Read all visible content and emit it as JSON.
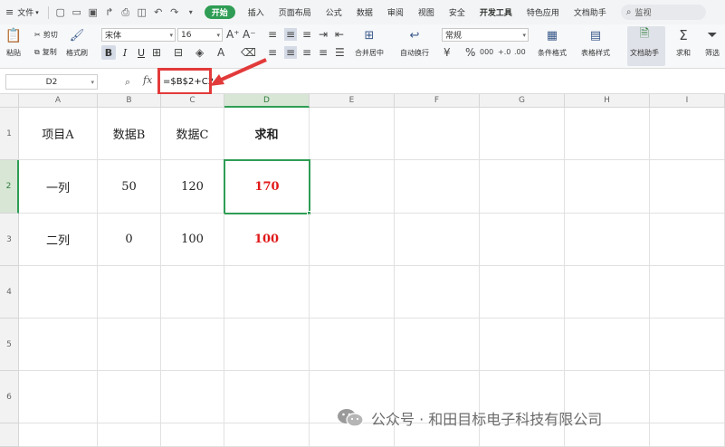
{
  "menubar": {
    "file_label": "文件",
    "tabs": [
      "开始",
      "插入",
      "页面布局",
      "公式",
      "数据",
      "审阅",
      "视图",
      "安全",
      "开发工具",
      "特色应用",
      "文档助手"
    ],
    "active_tab": "开始",
    "search_placeholder": "监视"
  },
  "ribbon": {
    "cut": "剪切",
    "paste": "粘贴",
    "copy": "复制",
    "format_painter": "格式刷",
    "font_name": "宋体",
    "font_size": "16",
    "merge_center": "合并居中",
    "wrap_text": "自动换行",
    "number_format": "常规",
    "conditional_format": "条件格式",
    "table_style": "表格样式",
    "doc_assistant": "文档助手",
    "sum": "求和",
    "filter": "筛选",
    "bold_label": "B",
    "italic_label": "I",
    "underline_label": "U",
    "percent": "%",
    "thousands": "000",
    "dec_inc": "+.0",
    "dec_dec": ".00"
  },
  "formula_bar": {
    "name_box": "D2",
    "fx_label": "fx",
    "formula": "=$B$2+C2"
  },
  "sheet": {
    "columns": [
      "A",
      "B",
      "C",
      "D",
      "E",
      "F",
      "G",
      "H",
      "I"
    ],
    "rows": [
      "1",
      "2",
      "3",
      "4",
      "5",
      "6"
    ],
    "cells": [
      [
        "项目A",
        "数据B",
        "数据C",
        "求和"
      ],
      [
        "一列",
        "50",
        "120",
        "170"
      ],
      [
        "二列",
        "0",
        "100",
        "100"
      ]
    ],
    "active_cell": "D2"
  },
  "watermark": {
    "text": "公众号 · 和田目标电子科技有限公司"
  },
  "colors": {
    "accent": "#2f9d55",
    "highlight_red": "#e23a3a",
    "result_red": "#e01818"
  }
}
